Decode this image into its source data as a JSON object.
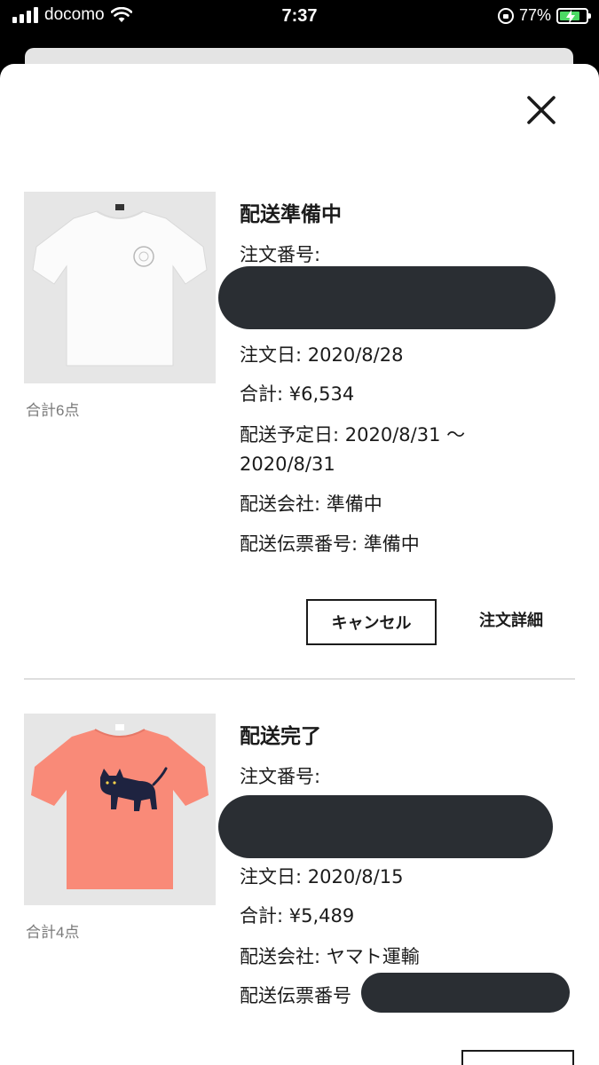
{
  "status_bar": {
    "carrier": "docomo",
    "time": "7:37",
    "battery_percent": "77%",
    "battery_level": 0.77
  },
  "colors": {
    "sheet_bg": "#ffffff",
    "redaction": "#2a2e33",
    "tshirt_coral": "#f98a78",
    "battery_green": "#4cd964"
  },
  "icons": {
    "close": "close-icon",
    "signal": "signal-icon",
    "wifi": "wifi-icon",
    "battery": "battery-icon"
  },
  "orders": [
    {
      "status": "配送準備中",
      "order_number_label": "注文番号:",
      "order_date": "注文日: 2020/8/28",
      "total": "合計: ¥6,534",
      "delivery_date_line1": "配送予定日: 2020/8/31 〜",
      "delivery_date_line2": "2020/8/31",
      "carrier": "配送会社: 準備中",
      "tracking": "配送伝票番号: 準備中",
      "qty": "合計6点",
      "cancel_label": "キャンセル",
      "detail_label": "注文詳細"
    },
    {
      "status": "配送完了",
      "order_number_label": "注文番号:",
      "order_date": "注文日: 2020/8/15",
      "total": "合計: ¥5,489",
      "carrier": "配送会社: ヤマト運輸",
      "tracking": "配送伝票番号",
      "qty": "合計4点"
    }
  ]
}
